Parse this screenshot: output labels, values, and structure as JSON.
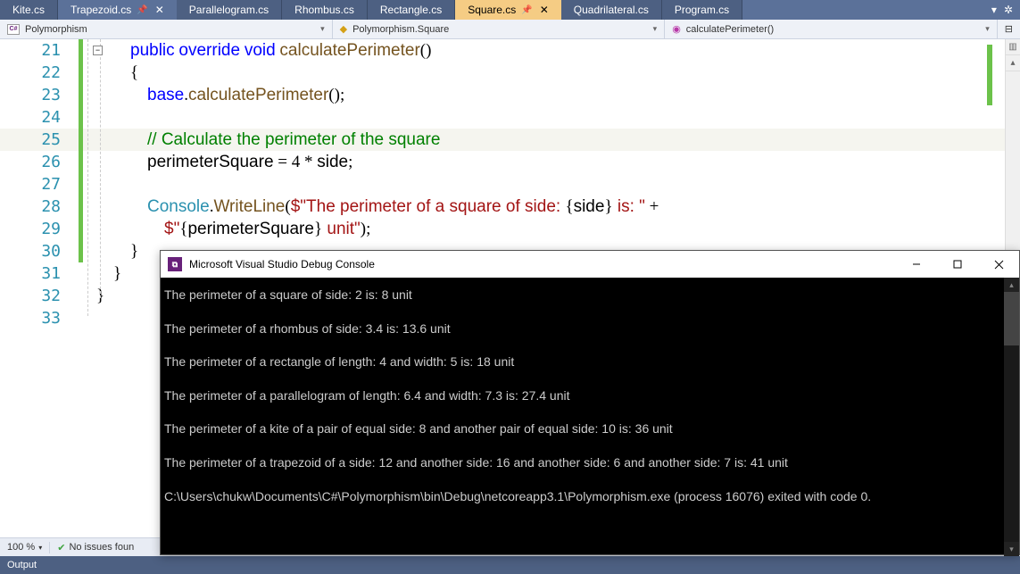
{
  "tabs": [
    {
      "label": "Kite.cs",
      "state": "inactive"
    },
    {
      "label": "Trapezoid.cs",
      "state": "pinned",
      "pinned": true,
      "close": true
    },
    {
      "label": "Parallelogram.cs",
      "state": "inactive"
    },
    {
      "label": "Rhombus.cs",
      "state": "inactive"
    },
    {
      "label": "Rectangle.cs",
      "state": "inactive"
    },
    {
      "label": "Square.cs",
      "state": "active",
      "pinned": true,
      "close": true
    },
    {
      "label": "Quadrilateral.cs",
      "state": "inactive"
    },
    {
      "label": "Program.cs",
      "state": "inactive"
    }
  ],
  "nav": {
    "project": "Polymorphism",
    "class": "Polymorphism.Square",
    "member": "calculatePerimeter()"
  },
  "code_lines": [
    {
      "n": 21,
      "html": "        <span class='kw'>public</span> <span class='kw'>override</span> <span class='kw'>void</span> <span class='method'>calculatePerimeter</span>()"
    },
    {
      "n": 22,
      "html": "        {"
    },
    {
      "n": 23,
      "html": "            <span class='kw'>base</span>.<span class='method'>calculatePerimeter</span>();"
    },
    {
      "n": 24,
      "html": ""
    },
    {
      "n": 25,
      "html": "            <span class='comment'>// Calculate the perimeter of the square</span>",
      "hl": true
    },
    {
      "n": 26,
      "html": "            <span class='id'>perimeterSquare</span> = 4 * <span class='id'>side</span>;"
    },
    {
      "n": 27,
      "html": ""
    },
    {
      "n": 28,
      "html": "            <span class='type'>Console</span>.<span class='method'>WriteLine</span>(<span class='string'>$\"The perimeter of a square of side: </span>{<span class='id'>side</span>}<span class='string'> is: \"</span> +"
    },
    {
      "n": 29,
      "html": "                <span class='string'>$\"</span>{<span class='id'>perimeterSquare</span>}<span class='string'> unit\"</span>);"
    },
    {
      "n": 30,
      "html": "        }"
    },
    {
      "n": 31,
      "html": "    }"
    },
    {
      "n": 32,
      "html": "}"
    },
    {
      "n": 33,
      "html": ""
    }
  ],
  "console": {
    "title": "Microsoft Visual Studio Debug Console",
    "lines": [
      "The perimeter of a square of side: 2 is: 8 unit",
      "The perimeter of a rhombus of side: 3.4 is: 13.6 unit",
      "The perimeter of a rectangle of length: 4 and width: 5 is: 18 unit",
      "The perimeter of a parallelogram of length: 6.4 and width: 7.3 is: 27.4 unit",
      "The perimeter of a kite of a pair of equal side: 8 and another pair of equal side: 10 is: 36 unit",
      "The perimeter of a trapezoid of a side: 12 and another side: 16 and another side: 6 and another side: 7 is: 41 unit",
      "",
      "C:\\Users\\chukw\\Documents\\C#\\Polymorphism\\bin\\Debug\\netcoreapp3.1\\Polymorphism.exe (process 16076) exited with code 0."
    ]
  },
  "status": {
    "zoom": "100 %",
    "issues": "No issues foun"
  },
  "output_label": "Output"
}
